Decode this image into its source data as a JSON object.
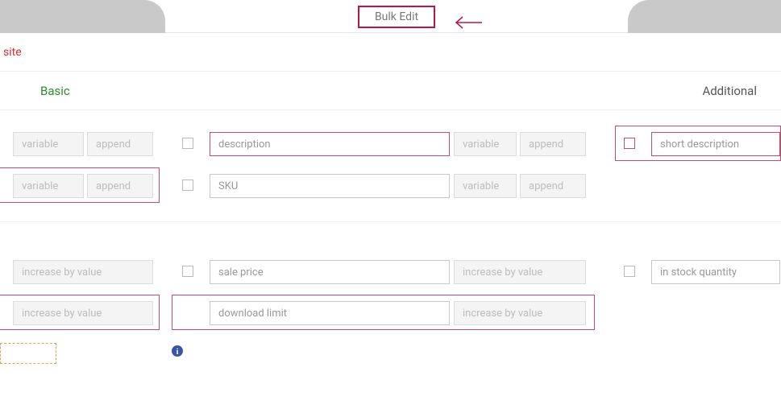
{
  "header": {
    "active_tab_label": "Bulk Edit"
  },
  "site_label": "site",
  "sub_tabs": {
    "basic": "Basic",
    "additional": "Additional"
  },
  "labels": {
    "variable": "variable",
    "append": "append",
    "increase_by_value": "increase by value"
  },
  "fields": {
    "description": {
      "placeholder": "description"
    },
    "short_description": {
      "placeholder": "short description"
    },
    "sku": {
      "placeholder": "SKU"
    },
    "sale_price": {
      "placeholder": "sale price"
    },
    "in_stock_quantity": {
      "placeholder": "in stock quantity"
    },
    "download_limit": {
      "placeholder": "download limit"
    }
  }
}
